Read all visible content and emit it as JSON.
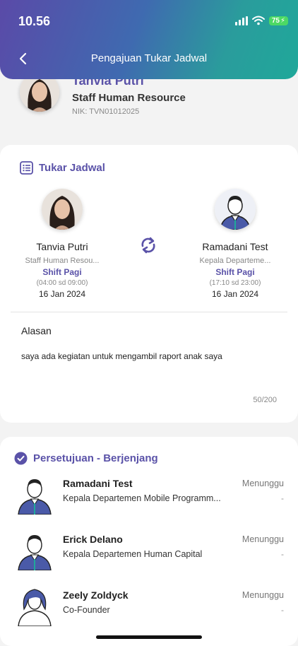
{
  "status_bar": {
    "time": "10.56",
    "battery": "75"
  },
  "header": {
    "title": "Pengajuan Tukar Jadwal"
  },
  "profile": {
    "name": "Tanvia Putri",
    "role": "Staff Human Resource",
    "nik": "NIK: TVN01012025"
  },
  "swap": {
    "title": "Tukar Jadwal",
    "from": {
      "name": "Tanvia Putri",
      "role": "Staff Human Resou...",
      "shift": "Shift Pagi",
      "time": "(04:00 sd 09:00)",
      "date": "16 Jan 2024"
    },
    "to": {
      "name": "Ramadani Test",
      "role": "Kepala Departeme...",
      "shift": "Shift Pagi",
      "time": "(17:10 sd 23:00)",
      "date": "16 Jan 2024"
    },
    "reason_label": "Alasan",
    "reason_text": "saya ada kegiatan untuk mengambil raport anak saya",
    "reason_count": "50/200"
  },
  "approval": {
    "title": "Persetujuan - Berjenjang",
    "approvers": [
      {
        "name": "Ramadani Test",
        "role": "Kepala Departemen Mobile Programm...",
        "status": "Menunggu",
        "note": "-"
      },
      {
        "name": "Erick Delano",
        "role": "Kepala Departemen Human Capital",
        "status": "Menunggu",
        "note": "-"
      },
      {
        "name": "Zeely Zoldyck",
        "role": "Co-Founder",
        "status": "Menunggu",
        "note": "-"
      }
    ]
  },
  "colors": {
    "accent": "#5a52a8",
    "header_start": "#5a4aa8",
    "header_end": "#1fa89a"
  }
}
